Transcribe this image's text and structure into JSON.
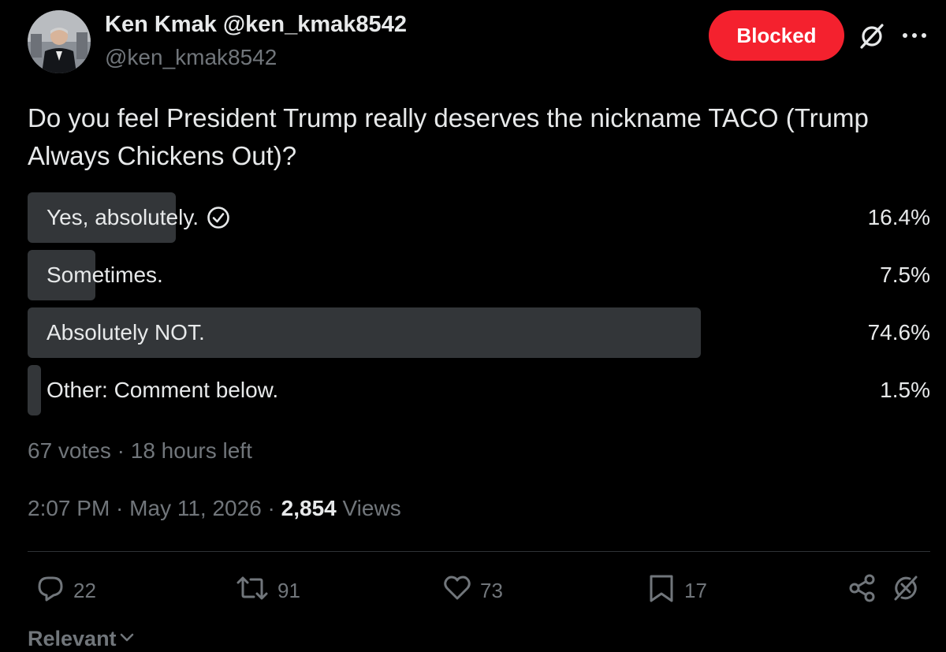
{
  "author": {
    "display_name": "Ken Kmak @ken_kmak8542",
    "handle": "@ken_kmak8542"
  },
  "header": {
    "blocked_label": "Blocked",
    "grok_icon": "grok-icon",
    "more_icon": "more-icon"
  },
  "post": {
    "text": "Do you feel President Trump really deserves the nickname TACO (Trump Always Chickens Out)?"
  },
  "poll": {
    "options": [
      {
        "label": "Yes, absolutely.",
        "percent_text": "16.4%",
        "percent": 16.4,
        "selected": true
      },
      {
        "label": "Sometimes.",
        "percent_text": "7.5%",
        "percent": 7.5,
        "selected": false
      },
      {
        "label": "Absolutely NOT.",
        "percent_text": "74.6%",
        "percent": 74.6,
        "selected": false
      },
      {
        "label": "Other: Comment below.",
        "percent_text": "1.5%",
        "percent": 1.5,
        "selected": false
      }
    ],
    "votes": "67 votes",
    "separator": " · ",
    "time_left": "18 hours left"
  },
  "meta": {
    "time": "2:07 PM",
    "separator": " · ",
    "date": "May 11, 2026",
    "views_count": "2,854",
    "views_label": "Views"
  },
  "actions": {
    "replies": "22",
    "reposts": "91",
    "likes": "73",
    "bookmarks": "17"
  },
  "sort": {
    "label": "Relevant"
  },
  "colors": {
    "background": "#000000",
    "blocked": "#f4212e",
    "poll_fill": "#333639",
    "muted": "#71767b",
    "text": "#e7e9ea"
  }
}
